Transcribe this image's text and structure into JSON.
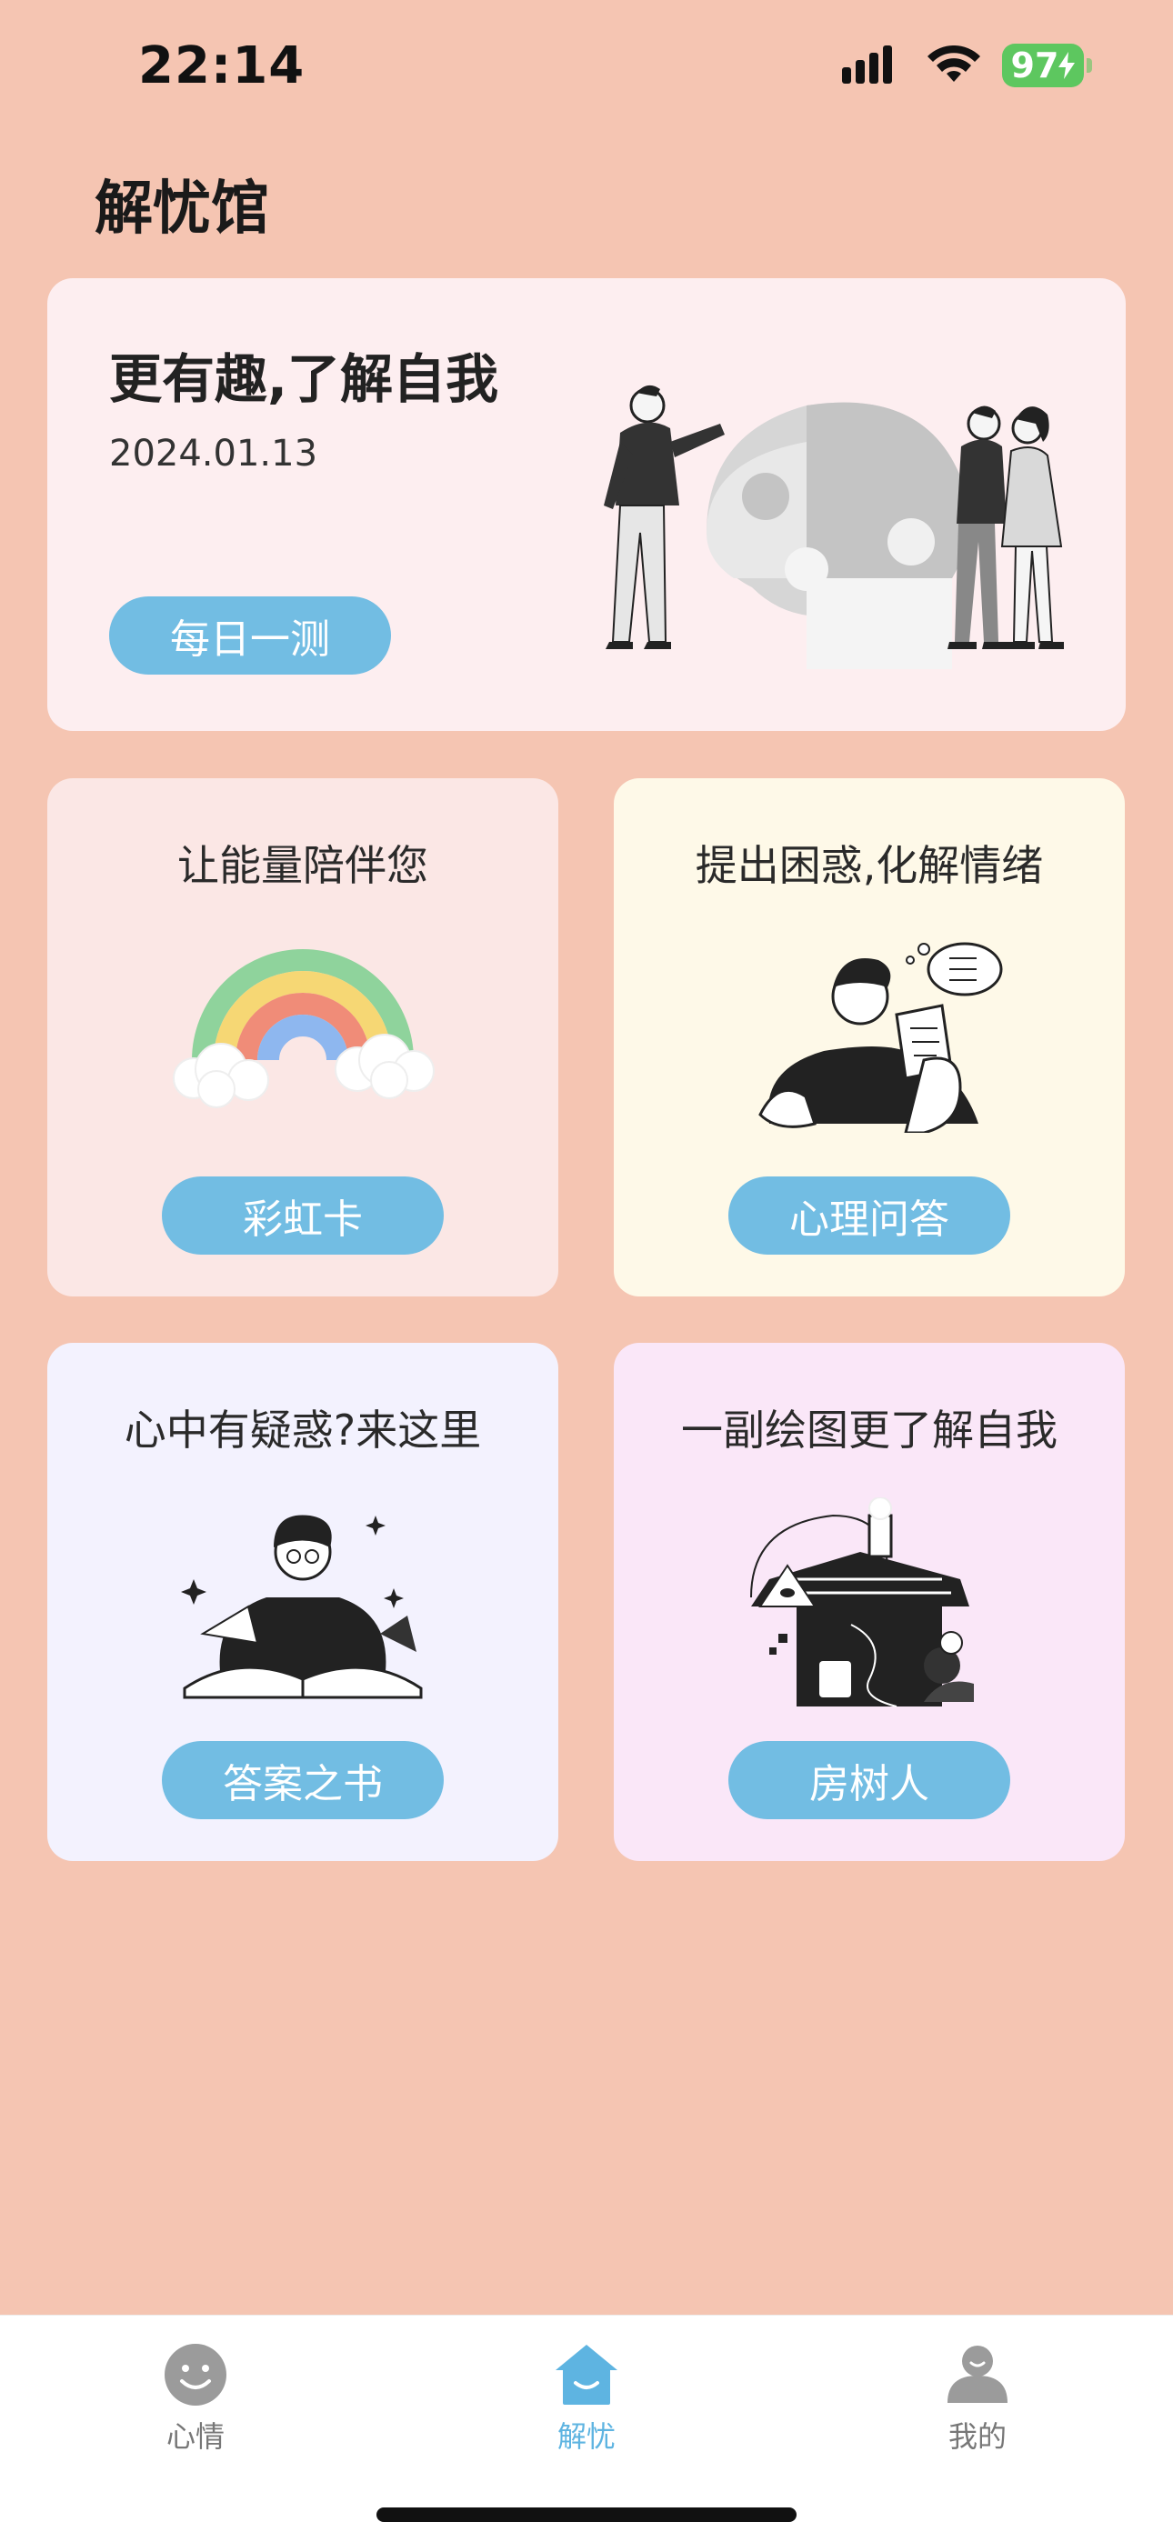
{
  "status": {
    "time": "22:14",
    "battery": "97"
  },
  "page": {
    "title": "解忧馆"
  },
  "hero": {
    "title": "更有趣,了解自我",
    "date": "2024.01.13",
    "button_label": "每日一测"
  },
  "tiles": [
    {
      "title": "让能量陪伴您",
      "button_label": "彩虹卡",
      "icon": "rainbow-illustration"
    },
    {
      "title": "提出困惑,化解情绪",
      "button_label": "心理问答",
      "icon": "thinking-person-illustration"
    },
    {
      "title": "心中有疑惑?来这里",
      "button_label": "答案之书",
      "icon": "reading-book-illustration"
    },
    {
      "title": "一副绘图更了解自我",
      "button_label": "房树人",
      "icon": "house-tree-person-illustration"
    }
  ],
  "tabbar": {
    "items": [
      {
        "label": "心情",
        "icon": "smiley-icon",
        "active": false
      },
      {
        "label": "解忧",
        "icon": "home-icon",
        "active": true
      },
      {
        "label": "我的",
        "icon": "person-icon",
        "active": false
      }
    ]
  },
  "colors": {
    "background": "#f5c5b2",
    "accent": "#72bde3",
    "tab_active": "#5eb4e1"
  }
}
